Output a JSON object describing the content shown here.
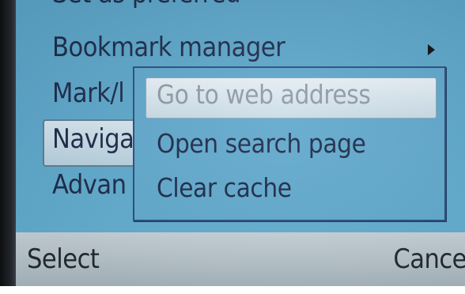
{
  "main_menu": {
    "items": [
      {
        "label": "Set as preferred"
      },
      {
        "label": "Bookmark manager",
        "has_submenu": true
      },
      {
        "label": "Mark/l"
      },
      {
        "label": "Naviga",
        "selected": true
      },
      {
        "label": "Advan"
      }
    ]
  },
  "submenu": {
    "items": [
      {
        "label": "Go to web address",
        "highlighted": true
      },
      {
        "label": "Open search page"
      },
      {
        "label": "Clear cache"
      }
    ]
  },
  "softkeys": {
    "left": "Select",
    "right": "Cancel"
  },
  "colors": {
    "screen_bg": "#5ea8cc",
    "text": "#1d2b4a",
    "highlight": "#d7e6ef",
    "highlight_text": "#8e9aa6",
    "softbar": "#b7c4cb"
  },
  "icons": {
    "submenu_arrow": "triangle-right"
  }
}
